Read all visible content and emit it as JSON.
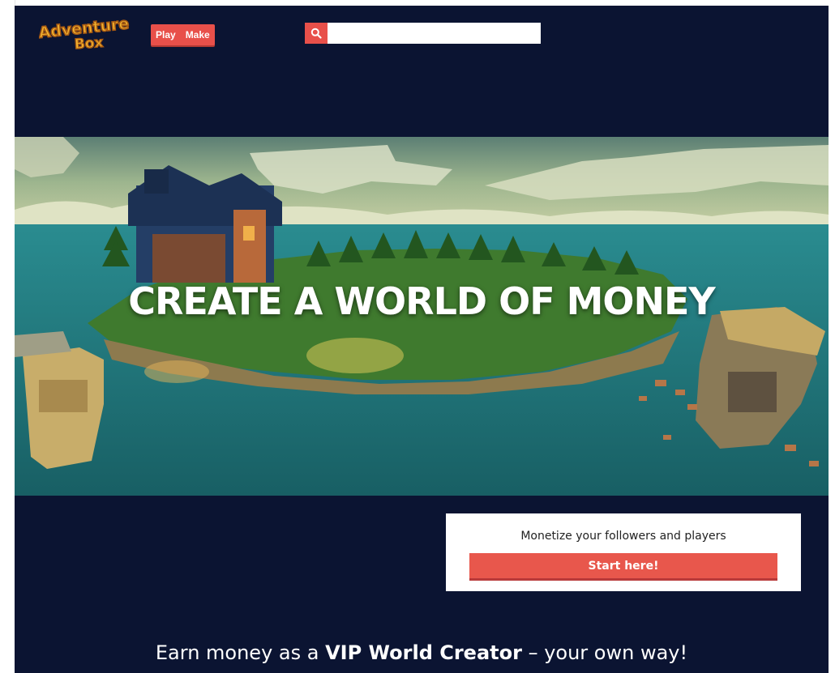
{
  "header": {
    "logo_text_line1": "Adventure",
    "logo_text_line2": "Box",
    "nav": [
      {
        "label": "Play"
      },
      {
        "label": "Make"
      }
    ],
    "search": {
      "placeholder": "",
      "value": "",
      "icon": "search-icon"
    }
  },
  "hero": {
    "title": "CREATE A WORLD OF MONEY"
  },
  "cta": {
    "text": "Monetize your followers and players",
    "button_label": "Start here!"
  },
  "tagline": {
    "prefix": "Earn money as a ",
    "emphasis": "VIP World Creator",
    "suffix": " – your own way!"
  },
  "colors": {
    "background": "#0b1432",
    "accent": "#e8504a",
    "cta_button": "#e8574c"
  }
}
